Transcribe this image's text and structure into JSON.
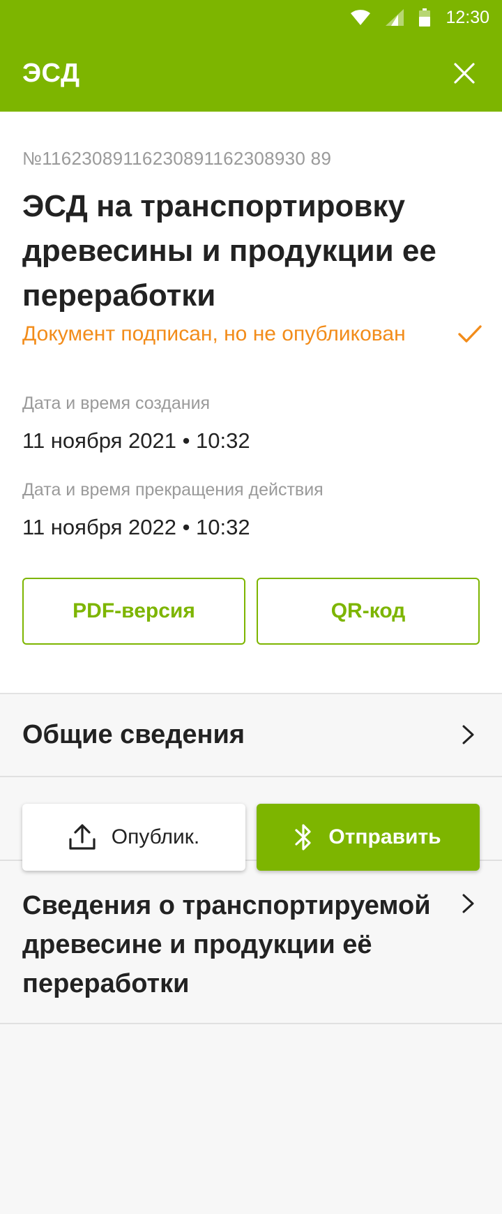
{
  "status_bar": {
    "time": "12:30"
  },
  "appbar": {
    "title": "ЭСД"
  },
  "document": {
    "number": "№11623089116230891162308930 89",
    "title": "ЭСД на транспортировку древесины и продукции ее переработки",
    "status_text": "Документ подписан, но не опубликован",
    "created_label": "Дата и время создания",
    "created_value": "11 ноября 2021 • 10:32",
    "expires_label": "Дата и время прекращения действия",
    "expires_value": "11 ноября 2022 • 10:32"
  },
  "buttons": {
    "pdf": "PDF-версия",
    "qr": "QR-код",
    "publish": "Опублик.",
    "send": "Отправить"
  },
  "sections": [
    {
      "title": "Общие сведения"
    },
    {
      "title": ""
    },
    {
      "title": "Сведения о транспортируемой древесине и продукции её переработки"
    }
  ],
  "colors": {
    "accent": "#7db500",
    "warning": "#f28c1a"
  }
}
